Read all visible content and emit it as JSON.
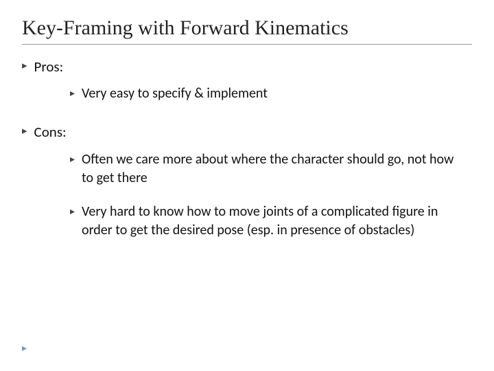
{
  "slide": {
    "title": "Key-Framing with Forward Kinematics",
    "pros_label": "Pros:",
    "cons_label": "Cons:",
    "pros_items": [
      "Very easy to specify & implement"
    ],
    "cons_items": [
      "Often we care more about where the character should go, not how to get there",
      "Very hard to know how to move joints of a complicated figure in order to get the desired pose (esp. in presence of obstacles)"
    ]
  }
}
